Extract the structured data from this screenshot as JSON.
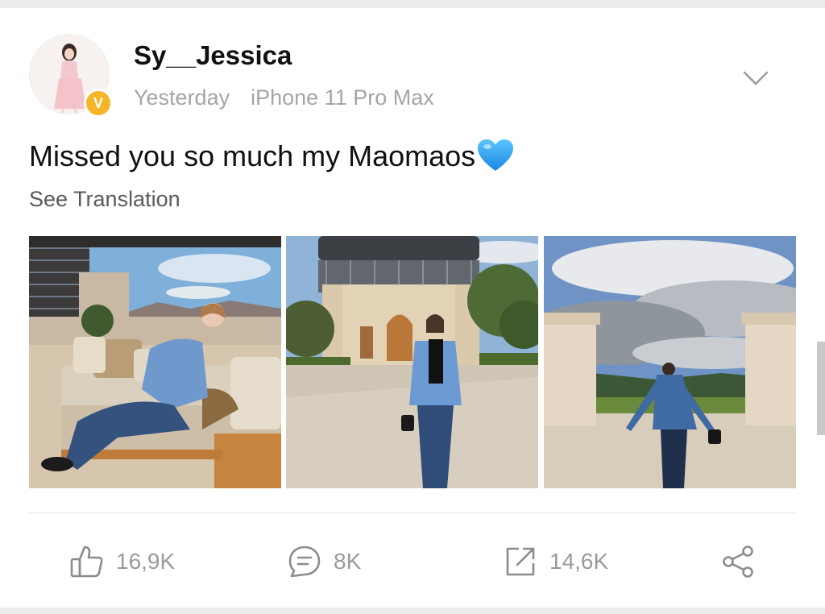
{
  "post": {
    "username": "Sy__Jessica",
    "time": "Yesterday",
    "device": "iPhone 11 Pro Max",
    "text": "Missed you so much my Maomaos",
    "see_translation": "See Translation",
    "verified_badge": "V"
  },
  "actions": {
    "likes": "16,9K",
    "comments": "8K",
    "reposts": "14,6K"
  },
  "icons": {
    "menu": "chevron-down-icon",
    "like": "thumbs-up-icon",
    "comment": "comment-icon",
    "repost": "repost-icon",
    "share": "share-icon",
    "emoji": "blue-heart-emoji"
  },
  "colors": {
    "verified": "#f5b526",
    "text": "#111111",
    "muted": "#a5a5a5",
    "heart": "#2b9bf0"
  }
}
